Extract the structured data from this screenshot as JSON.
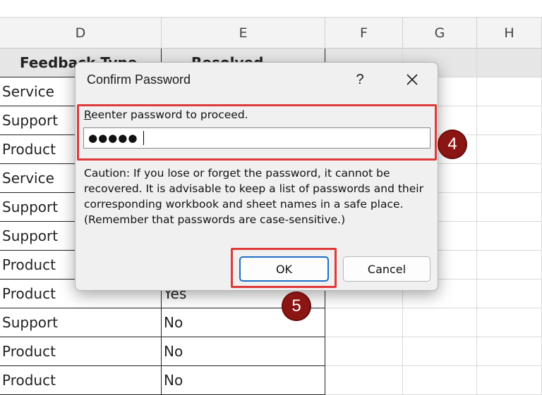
{
  "columns": [
    {
      "letter": "D"
    },
    {
      "letter": "E"
    },
    {
      "letter": "F"
    },
    {
      "letter": "G"
    },
    {
      "letter": "H"
    }
  ],
  "header_row": {
    "d": "Feedback Type",
    "e": "Resolved"
  },
  "rows": [
    {
      "d": "Service",
      "e": ""
    },
    {
      "d": "Support",
      "e": ""
    },
    {
      "d": "Product",
      "e": ""
    },
    {
      "d": "Service",
      "e": ""
    },
    {
      "d": "Support",
      "e": ""
    },
    {
      "d": "Support",
      "e": ""
    },
    {
      "d": "Product",
      "e": ""
    },
    {
      "d": "Product",
      "e": "Yes"
    },
    {
      "d": "Support",
      "e": "No"
    },
    {
      "d": "Product",
      "e": "No"
    },
    {
      "d": "Product",
      "e": "No"
    }
  ],
  "dialog": {
    "title": "Confirm Password",
    "help_label": "?",
    "prompt_first": "R",
    "prompt_rest": "eenter password to proceed.",
    "password_value": "●●●●●",
    "caution": "Caution: If you lose or forget the password, it cannot be recovered. It is advisable to keep a list of passwords and their corresponding workbook and sheet names in a safe place.  (Remember that passwords are case-sensitive.)",
    "ok_label": "OK",
    "cancel_label": "Cancel"
  },
  "annotations": {
    "step4": "4",
    "step5": "5",
    "highlight_color": "#e0393a",
    "badge_color": "#8b1512"
  }
}
